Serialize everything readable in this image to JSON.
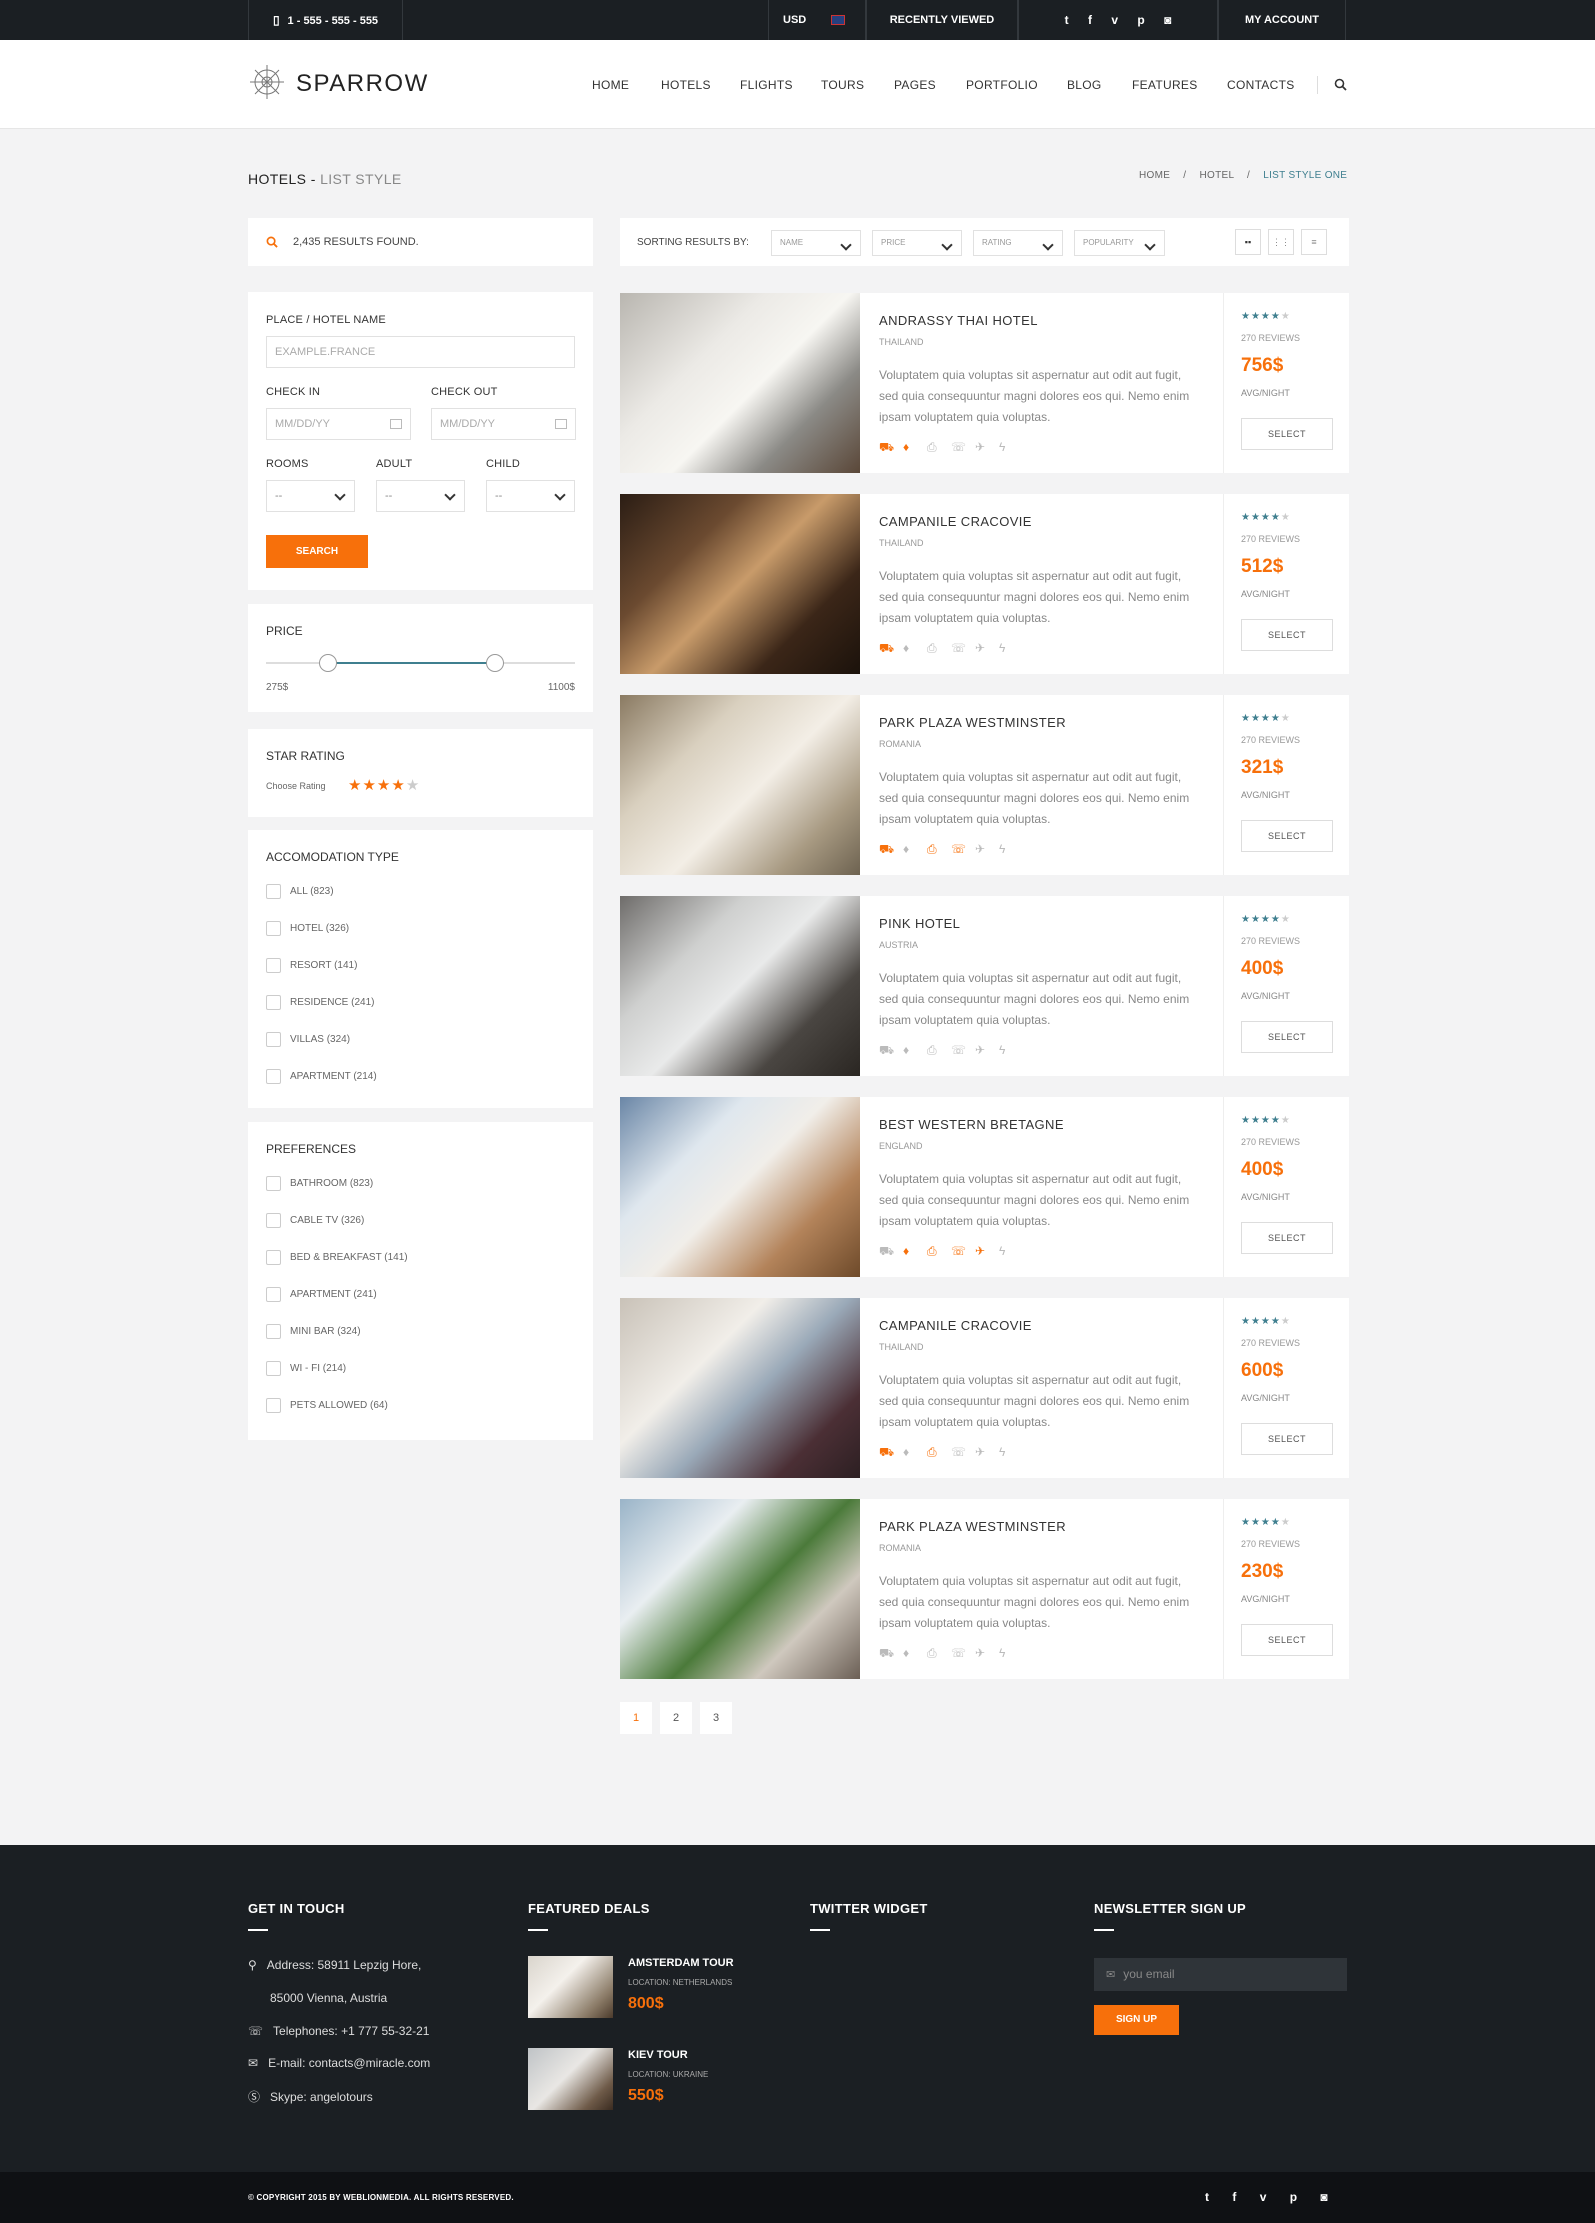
{
  "topbar": {
    "phone": "1 - 555 - 555 - 555",
    "currency": "USD",
    "recently_viewed": "RECENTLY VIEWED",
    "my_account": "MY ACCOUNT",
    "social": [
      "twitter-icon",
      "facebook-icon",
      "vimeo-icon",
      "pinterest-icon",
      "instagram-icon"
    ]
  },
  "header": {
    "logo": "SPARROW",
    "nav": [
      "HOME",
      "HOTELS",
      "FLIGHTS",
      "TOURS",
      "PAGES",
      "PORTFOLIO",
      "BLOG",
      "FEATURES",
      "CONTACTS"
    ]
  },
  "page": {
    "title_main": "HOTELS -",
    "title_sub": "LIST STYLE",
    "breadcrumb": [
      "HOME",
      "HOTEL",
      "LIST STYLE ONE"
    ]
  },
  "sidebar": {
    "results": "2,435 RESULTS FOUND.",
    "place_label": "PLACE / HOTEL NAME",
    "place_placeholder": "EXAMPLE.FRANCE",
    "checkin_label": "CHECK IN",
    "checkout_label": "CHECK OUT",
    "date_placeholder": "MM/DD/YY",
    "rooms_label": "ROOMS",
    "adult_label": "ADULT",
    "child_label": "CHILD",
    "select_default": "--",
    "search_btn": "SEARCH",
    "price_title": "PRICE",
    "price_min": "275$",
    "price_max": "1100$",
    "price_range_fraction": [
      0.2,
      0.74
    ],
    "star_title": "STAR RATING",
    "star_label": "Choose Rating",
    "star_value": 4,
    "accom_title": "ACCOMODATION TYPE",
    "accom": [
      "ALL (823)",
      "HOTEL (326)",
      "RESORT (141)",
      "RESIDENCE (241)",
      "VILLAS (324)",
      "APARTMENT (214)"
    ],
    "pref_title": "PREFERENCES",
    "prefs": [
      "BATHROOM (823)",
      "CABLE TV (326)",
      "BED & BREAKFAST (141)",
      "APARTMENT (241)",
      "MINI BAR (324)",
      "WI - FI (214)",
      "PETS ALLOWED (64)"
    ]
  },
  "sorting": {
    "label": "SORTING RESULTS BY:",
    "options": [
      "NAME",
      "PRICE",
      "RATING",
      "POPULARITY"
    ]
  },
  "hotels": [
    {
      "name": "ANDRASSY THAI HOTEL",
      "location": "THAILAND",
      "reviews": "270 REVIEWS",
      "price": "756$",
      "avg": "AVG/NIGHT",
      "select": "SELECT",
      "desc": "Voluptatem quia voluptas sit aspernatur aut odit aut fugit, sed quia consequuntur magni dolores eos qui. Nemo enim ipsam voluptatem quia voluptas."
    },
    {
      "name": "CAMPANILE CRACOVIE",
      "location": "THAILAND",
      "reviews": "270 REVIEWS",
      "price": "512$",
      "avg": "AVG/NIGHT",
      "select": "SELECT",
      "desc": "Voluptatem quia voluptas sit aspernatur aut odit aut fugit, sed quia consequuntur magni dolores eos qui. Nemo enim ipsam voluptatem quia voluptas."
    },
    {
      "name": "PARK PLAZA WESTMINSTER",
      "location": "ROMANIA",
      "reviews": "270 REVIEWS",
      "price": "321$",
      "avg": "AVG/NIGHT",
      "select": "SELECT",
      "desc": "Voluptatem quia voluptas sit aspernatur aut odit aut fugit, sed quia consequuntur magni dolores eos qui. Nemo enim ipsam voluptatem quia voluptas."
    },
    {
      "name": "PINK HOTEL",
      "location": "AUSTRIA",
      "reviews": "270 REVIEWS",
      "price": "400$",
      "avg": "AVG/NIGHT",
      "select": "SELECT",
      "desc": "Voluptatem quia voluptas sit aspernatur aut odit aut fugit, sed quia consequuntur magni dolores eos qui. Nemo enim ipsam voluptatem quia voluptas."
    },
    {
      "name": "BEST WESTERN BRETAGNE",
      "location": "ENGLAND",
      "reviews": "270 REVIEWS",
      "price": "400$",
      "avg": "AVG/NIGHT",
      "select": "SELECT",
      "desc": "Voluptatem quia voluptas sit aspernatur aut odit aut fugit, sed quia consequuntur magni dolores eos qui. Nemo enim ipsam voluptatem quia voluptas."
    },
    {
      "name": "CAMPANILE CRACOVIE",
      "location": "THAILAND",
      "reviews": "270 REVIEWS",
      "price": "600$",
      "avg": "AVG/NIGHT",
      "select": "SELECT",
      "desc": "Voluptatem quia voluptas sit aspernatur aut odit aut fugit, sed quia consequuntur magni dolores eos qui. Nemo enim ipsam voluptatem quia voluptas."
    },
    {
      "name": "PARK PLAZA WESTMINSTER",
      "location": "ROMANIA",
      "reviews": "270 REVIEWS",
      "price": "230$",
      "avg": "AVG/NIGHT",
      "select": "SELECT",
      "desc": "Voluptatem quia voluptas sit aspernatur aut odit aut fugit, sed quia consequuntur magni dolores eos qui. Nemo enim ipsam voluptatem quia voluptas."
    }
  ],
  "pagination": [
    "1",
    "2",
    "3"
  ],
  "footer": {
    "contact_title": "GET IN TOUCH",
    "address1": "Address: 58911 Lepzig Hore,",
    "address2": "85000 Vienna, Austria",
    "phone": "Telephones: +1 777 55-32-21",
    "email": "E-mail: contacts@miracle.com",
    "skype": "Skype: angelotours",
    "deals_title": "FEATURED DEALS",
    "deals": [
      {
        "name": "AMSTERDAM TOUR",
        "location": "LOCATION: NETHERLANDS",
        "price": "800$"
      },
      {
        "name": "KIEV TOUR",
        "location": "LOCATION: UKRAINE",
        "price": "550$"
      }
    ],
    "twitter_title": "TWITTER WIDGET",
    "news_title": "NEWSLETTER SIGN UP",
    "email_placeholder": "you email",
    "signup": "SIGN UP",
    "copyright": "© COPYRIGHT 2015 BY WEBLIONMEDIA. ALL RIGHTS RESERVED."
  },
  "colors": {
    "accent": "#f7700b",
    "dark": "#1b1f23",
    "teal": "#3f7f8f"
  }
}
